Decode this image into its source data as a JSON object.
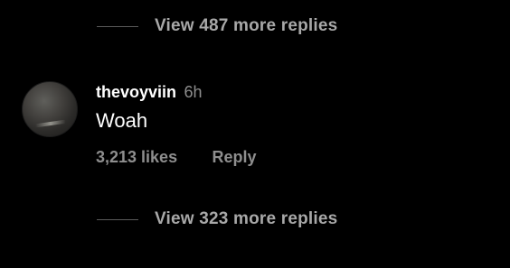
{
  "replies_top": {
    "label": "View 487 more replies"
  },
  "comment": {
    "username": "thevoyviin",
    "timestamp": "6h",
    "text": "Woah",
    "likes": "3,213 likes",
    "reply_label": "Reply",
    "avatar_icon": "profile-avatar"
  },
  "replies_bottom": {
    "label": "View 323 more replies"
  },
  "colors": {
    "background": "#000000",
    "primary_text": "#ffffff",
    "secondary_text": "#8e8e8e",
    "view_more_text": "#a8a8a8"
  }
}
